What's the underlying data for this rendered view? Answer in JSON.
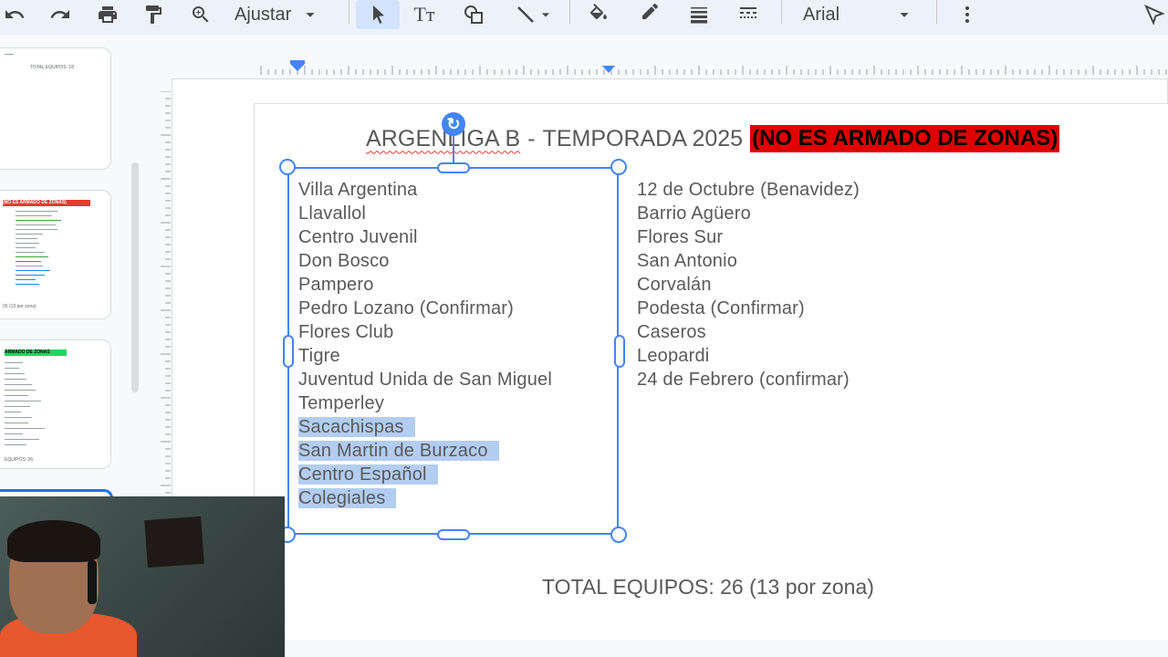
{
  "toolbar": {
    "zoom_label": "Ajustar",
    "font_name": "Arial",
    "icons": [
      "undo-icon",
      "redo-icon",
      "print-icon",
      "paint-format-icon",
      "zoom-icon",
      "chevron-down-icon",
      "select-icon",
      "text-box-icon",
      "shape-icon",
      "line-icon",
      "fill-color-icon",
      "border-color-icon",
      "border-weight-icon",
      "border-dash-icon",
      "more-icon",
      "pointer-icon"
    ]
  },
  "filmstrip": {
    "thumb1_text": "TOTAL EQUIPOS: 18",
    "thumb2_badge": "(NO ES ARMADO DE ZONAS)",
    "thumb2_footer": "26 (13 por zona)",
    "thumb3_badge": "ARMADO DE ZONAS",
    "thumb3_footer": "EQUIPOS: 26"
  },
  "slide": {
    "title": "ARGENLIGA B",
    "title_sep": "-",
    "title_season": "TEMPORADA 2025",
    "title_badge": "(NO ES ARMADO DE ZONAS)",
    "left_list": [
      "Villa Argentina",
      "Llavallol",
      "Centro Juvenil",
      "Don Bosco",
      "Pampero",
      "Pedro Lozano (Confirmar)",
      "Flores Club",
      "Tigre",
      "Juventud Unida de San Miguel",
      "Temperley",
      "Sacachispas",
      "San Martin de Burzaco",
      "Centro Español",
      "Colegiales"
    ],
    "right_list": [
      "12 de Octubre (Benavidez)",
      "Barrio Agüero",
      "Flores Sur",
      "San Antonio",
      "Corvalán",
      "Podesta (Confirmar)",
      "Caseros",
      "Leopardi",
      "24 de Febrero (confirmar)"
    ],
    "total": "TOTAL EQUIPOS: 26 (13 por zona)"
  },
  "colors": {
    "selection": "#4285f4",
    "highlight": "#b3cdf1",
    "badge_bg": "#e00000"
  }
}
